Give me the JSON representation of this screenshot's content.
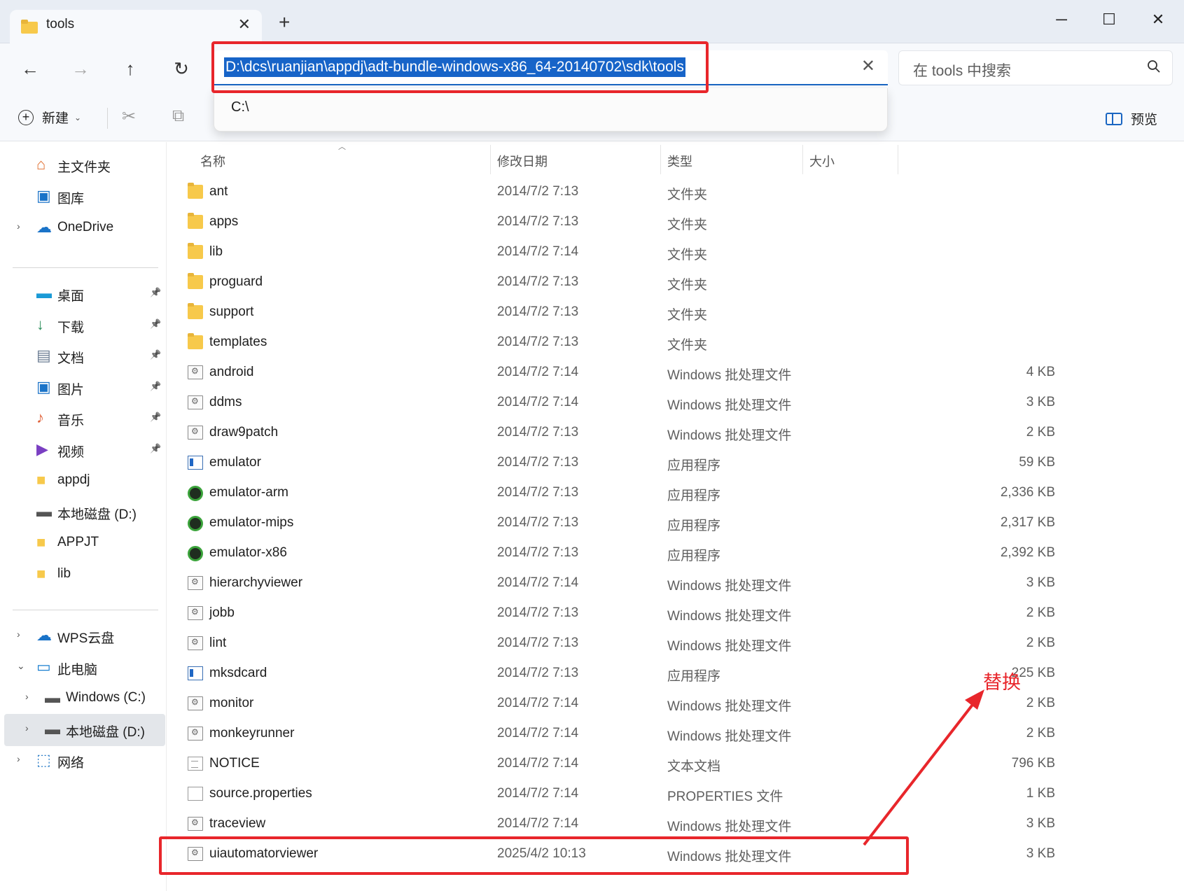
{
  "tab": {
    "title": "tools",
    "close": "✕",
    "new": "+"
  },
  "window": {
    "minimize": "─",
    "maximize": "☐",
    "close": "✕"
  },
  "nav": {
    "back": "←",
    "forward": "→",
    "up": "↑",
    "refresh": "↻"
  },
  "address": {
    "value": "D:\\dcs\\ruanjian\\appdj\\adt-bundle-windows-x86_64-20140702\\sdk\\tools",
    "clear": "✕",
    "suggestion": "C:\\"
  },
  "search": {
    "placeholder": "在 tools 中搜索"
  },
  "toolbar": {
    "new_label": "新建",
    "preview_label": "预览"
  },
  "sidebar": {
    "items": [
      {
        "label": "主文件夹",
        "icon": "home-icon"
      },
      {
        "label": "图库",
        "icon": "gallery-icon"
      },
      {
        "label": "OneDrive",
        "icon": "cloud-icon"
      },
      {
        "label": "桌面",
        "icon": "desktop-icon"
      },
      {
        "label": "下载",
        "icon": "download-icon"
      },
      {
        "label": "文档",
        "icon": "document-icon"
      },
      {
        "label": "图片",
        "icon": "pictures-icon"
      },
      {
        "label": "音乐",
        "icon": "music-icon"
      },
      {
        "label": "视频",
        "icon": "video-icon"
      },
      {
        "label": "appdj",
        "icon": "folder-icon"
      },
      {
        "label": "本地磁盘 (D:)",
        "icon": "drive-icon"
      },
      {
        "label": "APPJT",
        "icon": "folder-icon"
      },
      {
        "label": "lib",
        "icon": "folder-icon"
      },
      {
        "label": "WPS云盘",
        "icon": "cloud-icon"
      },
      {
        "label": "此电脑",
        "icon": "computer-icon"
      },
      {
        "label": "Windows (C:)",
        "icon": "drive-icon"
      },
      {
        "label": "本地磁盘 (D:)",
        "icon": "drive-icon"
      },
      {
        "label": "网络",
        "icon": "network-icon"
      }
    ]
  },
  "columns": {
    "name": "名称",
    "date": "修改日期",
    "type": "类型",
    "size": "大小"
  },
  "files": [
    {
      "name": "ant",
      "date": "2014/7/2 7:13",
      "type": "文件夹",
      "size": "",
      "icon": "folder"
    },
    {
      "name": "apps",
      "date": "2014/7/2 7:13",
      "type": "文件夹",
      "size": "",
      "icon": "folder"
    },
    {
      "name": "lib",
      "date": "2014/7/2 7:14",
      "type": "文件夹",
      "size": "",
      "icon": "folder"
    },
    {
      "name": "proguard",
      "date": "2014/7/2 7:13",
      "type": "文件夹",
      "size": "",
      "icon": "folder"
    },
    {
      "name": "support",
      "date": "2014/7/2 7:13",
      "type": "文件夹",
      "size": "",
      "icon": "folder"
    },
    {
      "name": "templates",
      "date": "2014/7/2 7:13",
      "type": "文件夹",
      "size": "",
      "icon": "folder"
    },
    {
      "name": "android",
      "date": "2014/7/2 7:14",
      "type": "Windows 批处理文件",
      "size": "4 KB",
      "icon": "bat"
    },
    {
      "name": "ddms",
      "date": "2014/7/2 7:14",
      "type": "Windows 批处理文件",
      "size": "3 KB",
      "icon": "bat"
    },
    {
      "name": "draw9patch",
      "date": "2014/7/2 7:13",
      "type": "Windows 批处理文件",
      "size": "2 KB",
      "icon": "bat"
    },
    {
      "name": "emulator",
      "date": "2014/7/2 7:13",
      "type": "应用程序",
      "size": "59 KB",
      "icon": "exe"
    },
    {
      "name": "emulator-arm",
      "date": "2014/7/2 7:13",
      "type": "应用程序",
      "size": "2,336 KB",
      "icon": "and"
    },
    {
      "name": "emulator-mips",
      "date": "2014/7/2 7:13",
      "type": "应用程序",
      "size": "2,317 KB",
      "icon": "and"
    },
    {
      "name": "emulator-x86",
      "date": "2014/7/2 7:13",
      "type": "应用程序",
      "size": "2,392 KB",
      "icon": "and"
    },
    {
      "name": "hierarchyviewer",
      "date": "2014/7/2 7:14",
      "type": "Windows 批处理文件",
      "size": "3 KB",
      "icon": "bat"
    },
    {
      "name": "jobb",
      "date": "2014/7/2 7:13",
      "type": "Windows 批处理文件",
      "size": "2 KB",
      "icon": "bat"
    },
    {
      "name": "lint",
      "date": "2014/7/2 7:13",
      "type": "Windows 批处理文件",
      "size": "2 KB",
      "icon": "bat"
    },
    {
      "name": "mksdcard",
      "date": "2014/7/2 7:13",
      "type": "应用程序",
      "size": "225 KB",
      "icon": "exe"
    },
    {
      "name": "monitor",
      "date": "2014/7/2 7:14",
      "type": "Windows 批处理文件",
      "size": "2 KB",
      "icon": "bat"
    },
    {
      "name": "monkeyrunner",
      "date": "2014/7/2 7:14",
      "type": "Windows 批处理文件",
      "size": "2 KB",
      "icon": "bat"
    },
    {
      "name": "NOTICE",
      "date": "2014/7/2 7:14",
      "type": "文本文档",
      "size": "796 KB",
      "icon": "txt"
    },
    {
      "name": "source.properties",
      "date": "2014/7/2 7:14",
      "type": "PROPERTIES 文件",
      "size": "1 KB",
      "icon": "file"
    },
    {
      "name": "traceview",
      "date": "2014/7/2 7:14",
      "type": "Windows 批处理文件",
      "size": "3 KB",
      "icon": "bat"
    },
    {
      "name": "uiautomatorviewer",
      "date": "2025/4/2 10:13",
      "type": "Windows 批处理文件",
      "size": "3 KB",
      "icon": "bat"
    }
  ],
  "annotation": {
    "label": "替换",
    "color": "#e8262b"
  },
  "colors": {
    "accent": "#1a66c2",
    "annotation": "#e8262b",
    "folder": "#f7c94b"
  }
}
